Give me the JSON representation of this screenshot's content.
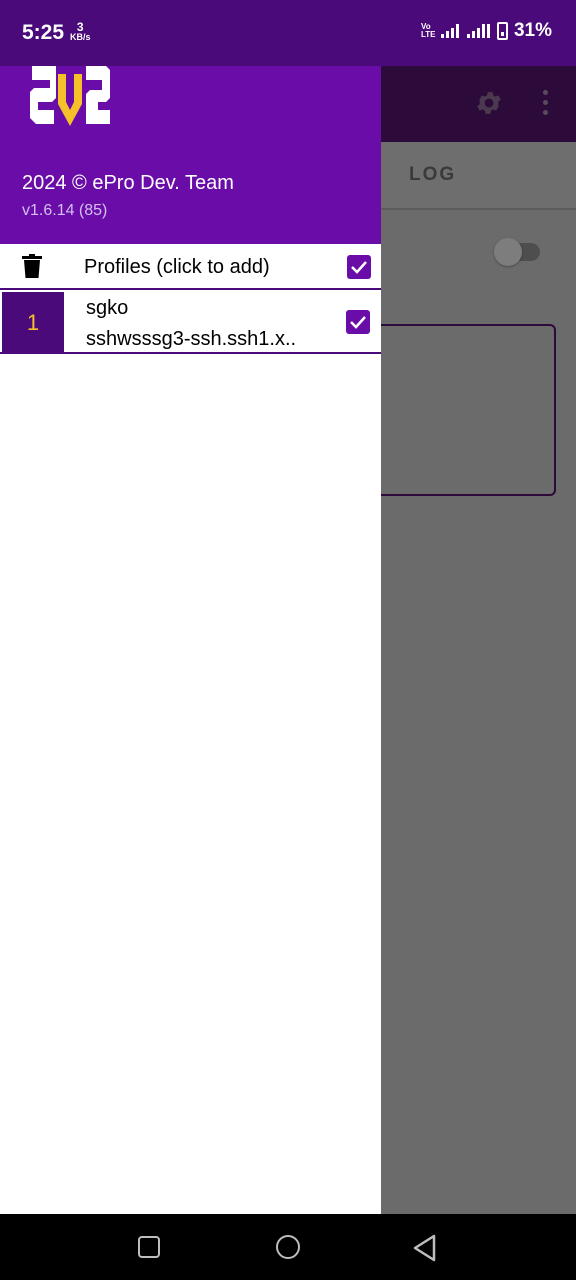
{
  "status_bar": {
    "time": "5:25",
    "net_speed_value": "3",
    "net_speed_unit": "KB/s",
    "network_labels": "Vo LTE",
    "battery_percent": "31%"
  },
  "app": {
    "tabs": [
      {
        "label": "LOG"
      }
    ],
    "connection_toggle_on": false
  },
  "drawer": {
    "copyright": "2024 © ePro Dev. Team",
    "version": "v1.6.14 (85)",
    "profiles_header": {
      "label": "Profiles (click to add)",
      "checked": true
    },
    "profiles": [
      {
        "index": "1",
        "name": "sgko",
        "host": "sshwsssg3-ssh.ssh1.x..",
        "checked": true
      }
    ]
  },
  "colors": {
    "primary": "#6a0da8",
    "primary_dark": "#4a0a7a",
    "accent": "#f5c02a"
  }
}
